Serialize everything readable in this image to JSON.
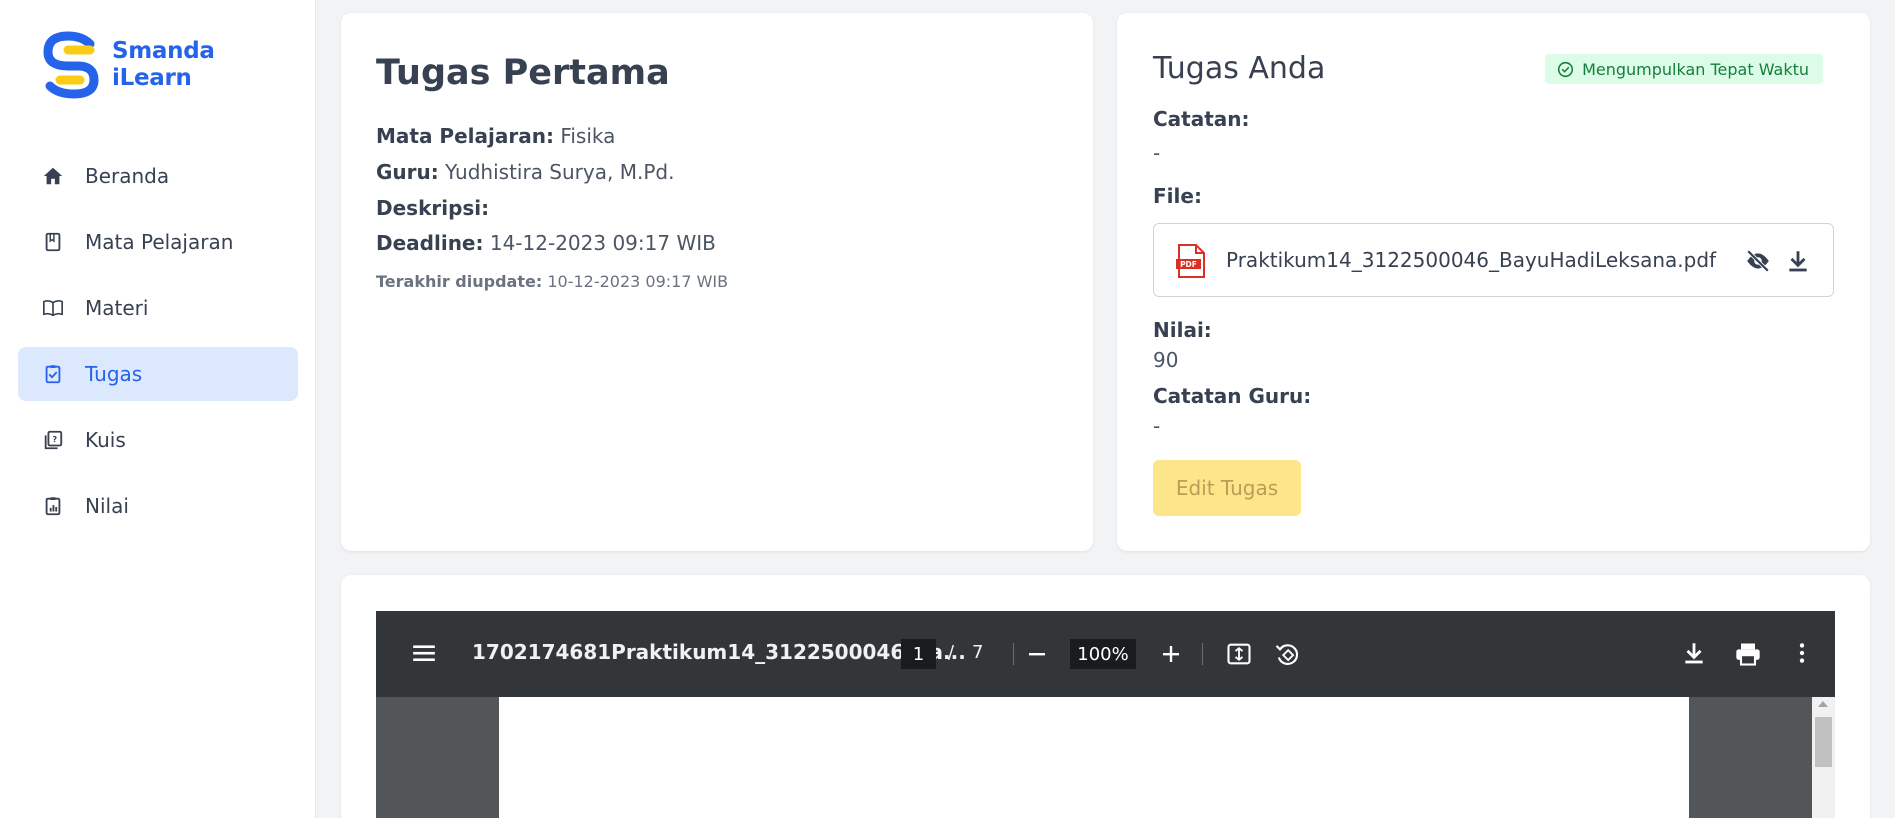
{
  "app": {
    "logo_line1": "Smanda",
    "logo_line2": "iLearn",
    "brand_color": "#2563eb",
    "accent_color": "#facc15"
  },
  "sidebar": {
    "items": [
      {
        "label": "Beranda",
        "icon": "home-icon",
        "active": false
      },
      {
        "label": "Mata Pelajaran",
        "icon": "book-icon",
        "active": false
      },
      {
        "label": "Materi",
        "icon": "open-book-icon",
        "active": false
      },
      {
        "label": "Tugas",
        "icon": "clipboard-check-icon",
        "active": true
      },
      {
        "label": "Kuis",
        "icon": "quiz-icon",
        "active": false
      },
      {
        "label": "Nilai",
        "icon": "report-icon",
        "active": false
      }
    ]
  },
  "assignment": {
    "title": "Tugas Pertama",
    "subject_label": "Mata Pelajaran:",
    "subject": "Fisika",
    "teacher_label": "Guru:",
    "teacher": "Yudhistira Surya, M.Pd.",
    "description_label": "Deskripsi:",
    "deadline_label": "Deadline:",
    "deadline": "14-12-2023 09:17 WIB",
    "updated_label": "Terakhir diupdate:",
    "updated": "10-12-2023 09:17 WIB"
  },
  "submission": {
    "title": "Tugas Anda",
    "status": "Mengumpulkan Tepat Waktu",
    "notes_label": "Catatan:",
    "notes": "-",
    "file_label": "File:",
    "file_icon_text": "PDF",
    "file_name": "Praktikum14_3122500046_BayuHadiLeksana.pdf",
    "grade_label": "Nilai:",
    "grade": "90",
    "teacher_notes_label": "Catatan Guru:",
    "teacher_notes": "-",
    "edit_button": "Edit Tugas"
  },
  "pdf_viewer": {
    "title": "1702174681Praktikum14_3122500046_Ba...",
    "current_page": "1",
    "page_separator": "/",
    "total_pages": "7",
    "zoom": "100%"
  }
}
